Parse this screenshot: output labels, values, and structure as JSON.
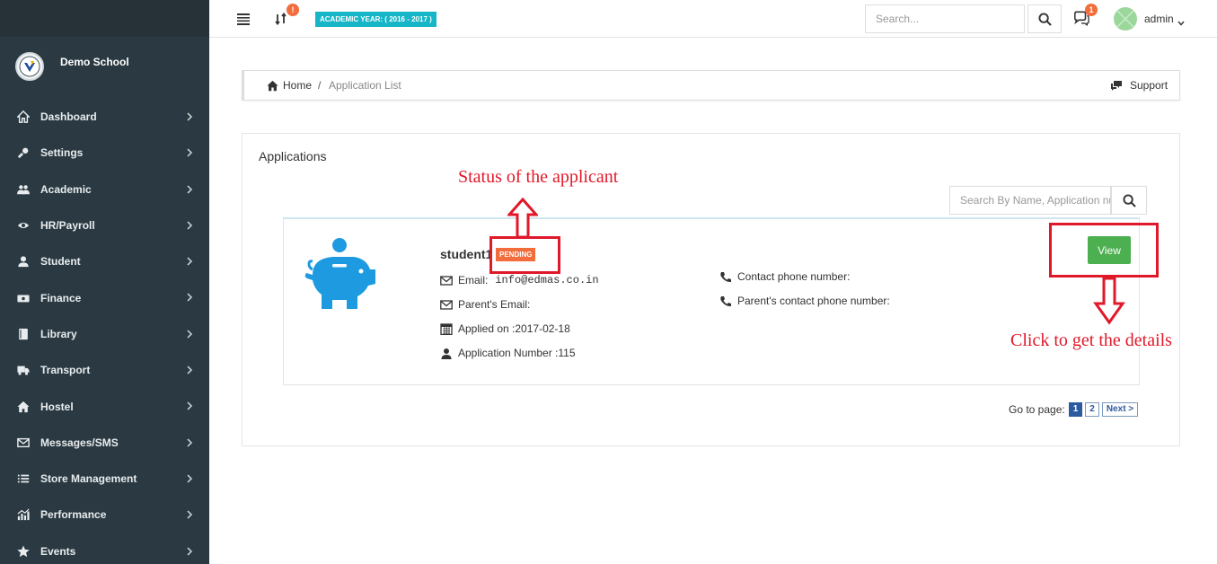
{
  "sidebar": {
    "school_name": "Demo School",
    "items": [
      {
        "label": "Dashboard",
        "icon": "home-icon"
      },
      {
        "label": "Settings",
        "icon": "wrench-icon"
      },
      {
        "label": "Academic",
        "icon": "users-icon"
      },
      {
        "label": "HR/Payroll",
        "icon": "eye-icon"
      },
      {
        "label": "Student",
        "icon": "user-icon"
      },
      {
        "label": "Finance",
        "icon": "money-icon"
      },
      {
        "label": "Library",
        "icon": "book-icon"
      },
      {
        "label": "Transport",
        "icon": "truck-icon"
      },
      {
        "label": "Hostel",
        "icon": "house-icon"
      },
      {
        "label": "Messages/SMS",
        "icon": "envelope-icon"
      },
      {
        "label": "Store Management",
        "icon": "list-icon"
      },
      {
        "label": "Performance",
        "icon": "chart-icon"
      },
      {
        "label": "Events",
        "icon": "star-icon"
      }
    ]
  },
  "topbar": {
    "sync_badge": "!",
    "academic_year": "ACADEMIC YEAR: ( 2016 - 2017 )",
    "search_placeholder": "Search...",
    "chat_badge": "1",
    "user_name": "admin"
  },
  "breadcrumb": {
    "home": "Home",
    "separator": "/",
    "current": "Application List",
    "support": "Support"
  },
  "panel": {
    "title": "Applications",
    "search_placeholder": "Search By Name, Application number"
  },
  "application": {
    "student_name": "student1",
    "status": "PENDING",
    "email_label": "Email:",
    "email_value": "info@edmas.co.in",
    "parent_email_label": "Parent's Email:",
    "applied_on": "Applied on :2017-02-18",
    "application_number": "Application Number :115",
    "contact_phone": "Contact phone number:",
    "parent_contact_phone": "Parent's contact phone number:",
    "view_label": "View"
  },
  "pagination": {
    "label": "Go to page:",
    "pages": [
      "1",
      "2"
    ],
    "next": "Next >"
  },
  "annotations": {
    "status_note": "Status of the applicant",
    "details_note": "Click to get the details",
    "color": "#e0192a"
  },
  "colors": {
    "sidebar_bg": "#2b3a42",
    "accent_teal": "#16b5c7",
    "badge_orange": "#f26c3c",
    "view_green": "#4caf50",
    "piggy_blue": "#1e9be0"
  }
}
